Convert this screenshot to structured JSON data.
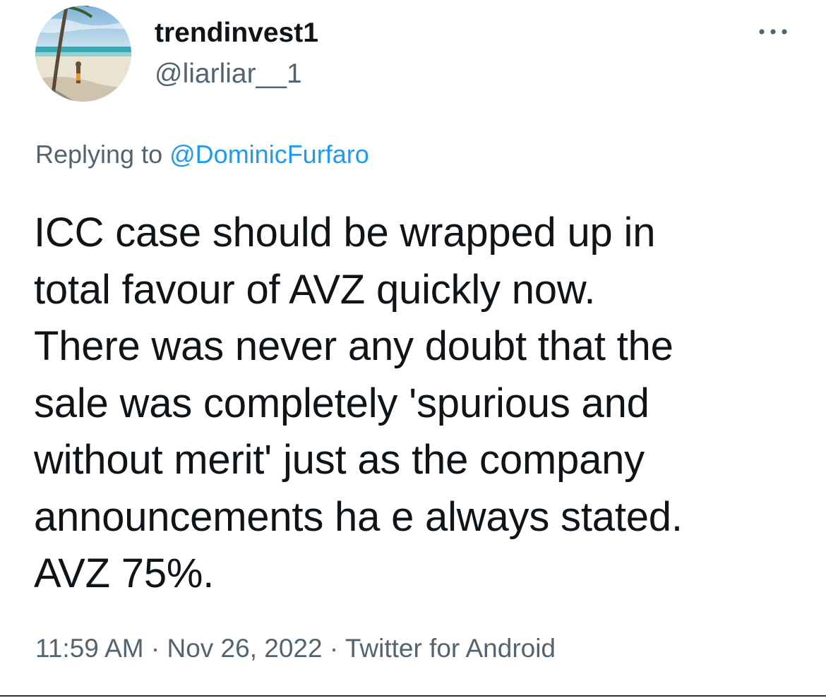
{
  "author": {
    "display_name": "trendinvest1",
    "handle": "@liarliar__1",
    "avatar_icon": "beach-photo-avatar"
  },
  "more_icon": "more-horizontal-icon",
  "reply_context": {
    "prefix": "Replying to",
    "mention": "@DominicFurfaro"
  },
  "tweet": {
    "lines": [
      "ICC case should be wrapped up in",
      "total favour of AVZ quickly now.",
      "There was never any doubt that the",
      "sale was completely 'spurious and",
      "without merit' just as the company",
      "announcements ha e always stated.",
      "AVZ 75%."
    ]
  },
  "meta": {
    "time": "11:59 AM",
    "separator": "·",
    "date": "Nov 26, 2022",
    "source": "Twitter for Android"
  },
  "colors": {
    "text": "#0f1419",
    "secondary": "#536471",
    "link": "#1d9bf0"
  }
}
